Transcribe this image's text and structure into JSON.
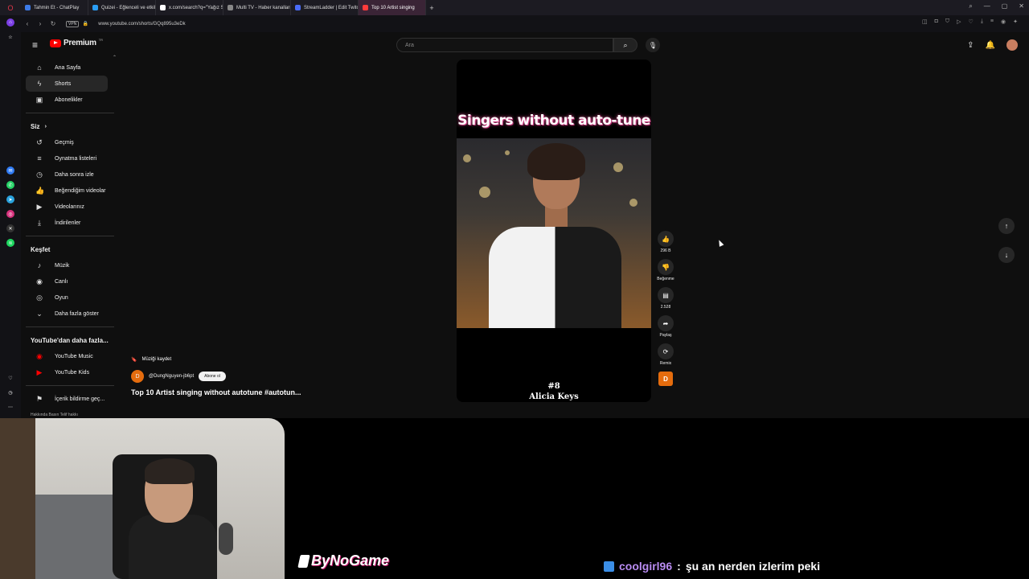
{
  "browser": {
    "tabs": [
      {
        "label": "Tahmin Et - ChatPlay",
        "color": "#3d7be8"
      },
      {
        "label": "Quizei - Eğlenceli ve etkile",
        "color": "#2a9df4"
      },
      {
        "label": "x.com/search?q=\"Yağız Sa",
        "color": "#ffffff"
      },
      {
        "label": "Multi TV - Haber kanalları",
        "color": "#888888"
      },
      {
        "label": "StreamLadder | Edit Twitch",
        "color": "#4a6cf7"
      },
      {
        "label": "Top 10 Artist singing",
        "color": "#ff3b3b",
        "active": true
      }
    ],
    "url": "www.youtube.com/shorts/GQq895u3eDk",
    "vpn_label": "VPN"
  },
  "youtube": {
    "logo_text": "Premium",
    "logo_superscript": "TR",
    "search_placeholder": "Ara",
    "nav_main": [
      {
        "label": "Ana Sayfa",
        "icon": "⌂",
        "name": "home"
      },
      {
        "label": "Shorts",
        "icon": "ϟ",
        "name": "shorts",
        "active": true
      },
      {
        "label": "Abonelikler",
        "icon": "▣",
        "name": "subscriptions"
      }
    ],
    "siz_label": "Siz",
    "nav_you": [
      {
        "label": "Geçmiş",
        "icon": "↺",
        "name": "history"
      },
      {
        "label": "Oynatma listeleri",
        "icon": "≡",
        "name": "playlists"
      },
      {
        "label": "Daha sonra izle",
        "icon": "◷",
        "name": "watch-later"
      },
      {
        "label": "Beğendiğim videolar",
        "icon": "👍",
        "name": "liked"
      },
      {
        "label": "Videolarınız",
        "icon": "▶",
        "name": "your-videos"
      },
      {
        "label": "İndirilenler",
        "icon": "⤓",
        "name": "downloads"
      }
    ],
    "explore_label": "Keşfet",
    "nav_explore": [
      {
        "label": "Müzik",
        "icon": "♪",
        "name": "music"
      },
      {
        "label": "Canlı",
        "icon": "◉",
        "name": "live"
      },
      {
        "label": "Oyun",
        "icon": "◎",
        "name": "gaming"
      },
      {
        "label": "Daha fazla göster",
        "icon": "⌄",
        "name": "show-more"
      }
    ],
    "more_label": "YouTube'dan daha fazla...",
    "nav_more": [
      {
        "label": "YouTube Music",
        "icon": "◉",
        "name": "yt-music"
      },
      {
        "label": "YouTube Kids",
        "icon": "▶",
        "name": "yt-kids"
      }
    ],
    "report_label": "İçerik bildirme geç...",
    "footer_links": "Hakkında  Basın  Telif hakkı",
    "short": {
      "overlay_title": "Singers without auto-tune",
      "caption_number": "#8",
      "caption_name": "Alicia Keys",
      "progress": 0.6
    },
    "actions": {
      "like_count": "296 B",
      "dislike_label": "Beğenme",
      "comment_count": "2.528",
      "share_label": "Paylaş",
      "remix_label": "Remix",
      "channel_letter": "D"
    },
    "meta": {
      "save_music_label": "Müziği kaydet",
      "channel_handle": "@DungNguyen-jb6pt",
      "channel_letter": "D",
      "subscribe_label": "Abone ol",
      "video_title": "Top 10 Artist singing without autotune #autotun..."
    }
  },
  "stream": {
    "brand": "ByNoGame",
    "chat_user": "coolgirl96",
    "chat_sep": ":",
    "chat_message": "şu an nerden izlerim peki"
  }
}
